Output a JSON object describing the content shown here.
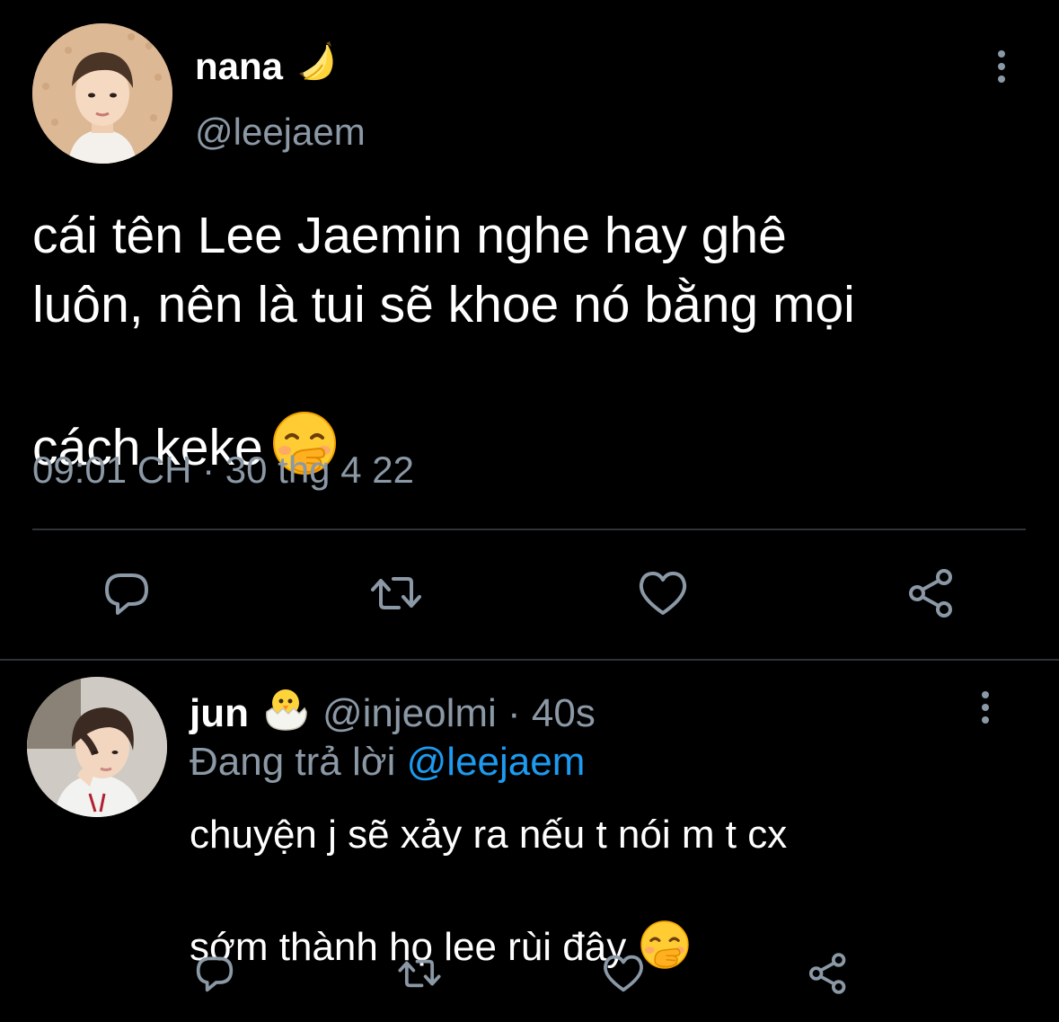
{
  "main_tweet": {
    "display_name": "nana",
    "name_emoji": "banana-emoji",
    "handle": "@leejaem",
    "text": "cái tên Lee Jaemin nghe hay ghê\nluôn, nên là tui sẽ khoe nó bằng mọi\ncách keke",
    "text_emoji": "face-with-hand-over-mouth-emoji",
    "timestamp": "09:01 CH · 30 thg 4 22",
    "actions": [
      "reply-icon",
      "retweet-icon",
      "like-icon",
      "share-icon"
    ]
  },
  "reply": {
    "display_name": "jun",
    "name_emoji": "hatching-chick-emoji",
    "handle_time": "@injeolmi · 40s",
    "replying_prefix": "Đang trả lời",
    "replying_to": "@leejaem",
    "text": "chuyện j sẽ xảy ra nếu t nói m t cx\nsớm thành họ lee rùi đây",
    "text_emoji": "face-with-hand-over-mouth-emoji",
    "actions": [
      "reply-icon",
      "retweet-icon",
      "like-icon",
      "share-icon"
    ]
  },
  "colors": {
    "background": "#000000",
    "primary_text": "#ffffff",
    "secondary_text": "#8b98a5",
    "link": "#1d9bf0",
    "divider": "#2f3336"
  }
}
